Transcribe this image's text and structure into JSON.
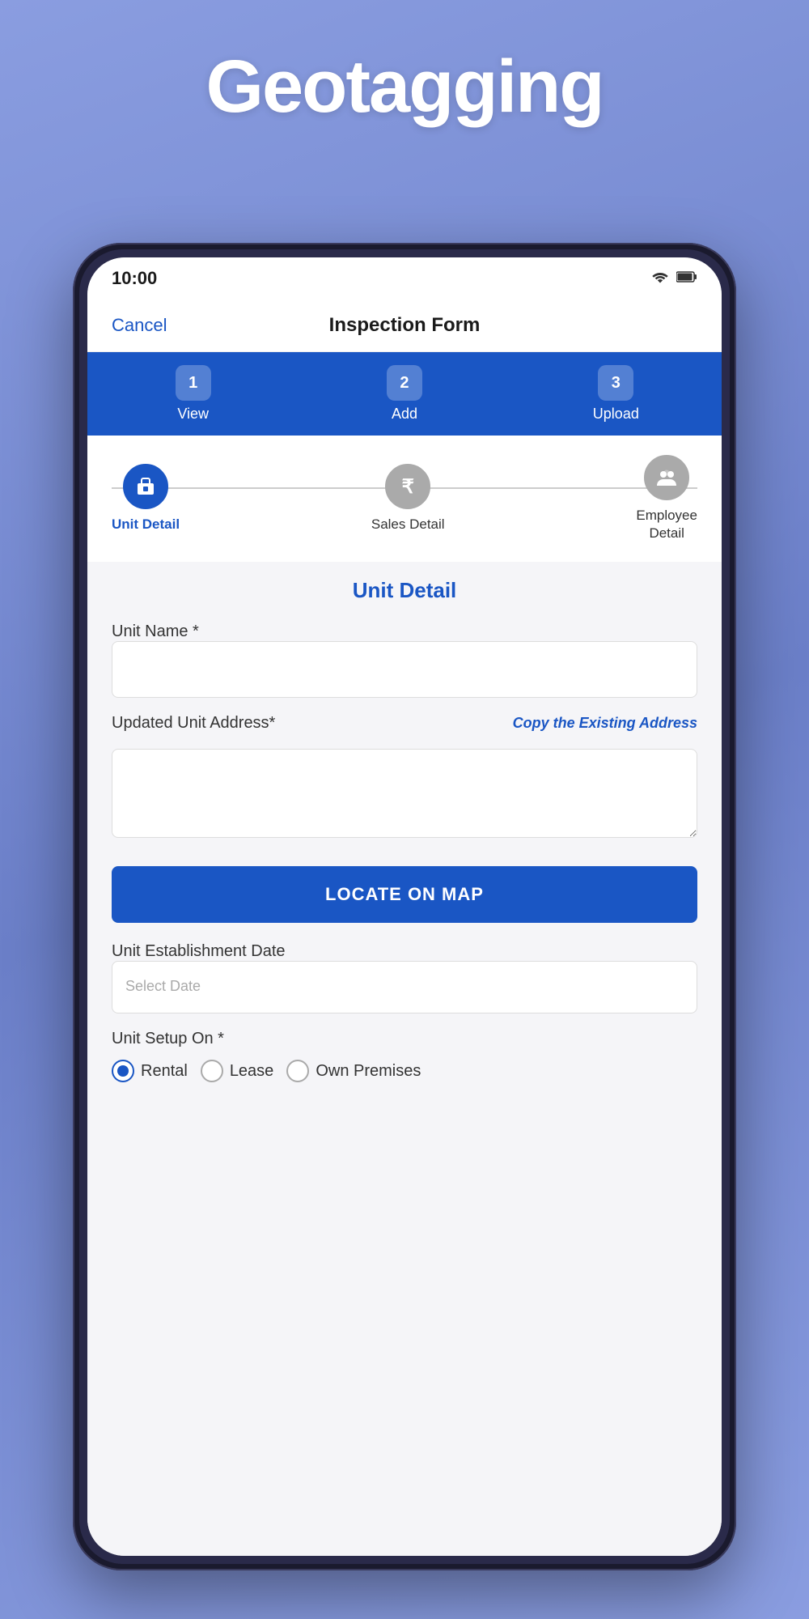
{
  "page": {
    "title": "Geotagging",
    "background_color": "#8a9de0"
  },
  "status_bar": {
    "time": "10:00",
    "wifi_icon": "wifi-icon",
    "battery_icon": "battery-icon"
  },
  "header": {
    "cancel_label": "Cancel",
    "title": "Inspection Form"
  },
  "tabs": [
    {
      "id": "view",
      "number": "1",
      "label": "View"
    },
    {
      "id": "add",
      "number": "2",
      "label": "Add"
    },
    {
      "id": "upload",
      "number": "3",
      "label": "Upload"
    }
  ],
  "stepper": {
    "steps": [
      {
        "id": "unit-detail",
        "icon": "🏪",
        "label": "Unit Detail",
        "state": "active"
      },
      {
        "id": "sales-detail",
        "icon": "₹",
        "label": "Sales Detail",
        "state": "inactive"
      },
      {
        "id": "employee-detail",
        "icon": "👥",
        "label": "Employee Detail",
        "state": "inactive"
      }
    ]
  },
  "form": {
    "section_title": "Unit Detail",
    "unit_name_label": "Unit Name *",
    "unit_name_placeholder": "",
    "unit_address_label": "Updated Unit Address*",
    "copy_address_label": "Copy the Existing Address",
    "unit_address_placeholder": "",
    "locate_btn_label": "LOCATE ON MAP",
    "establishment_date_label": "Unit Establishment Date",
    "establishment_date_placeholder": "Select Date",
    "unit_setup_label": "Unit Setup On *",
    "radio_options": [
      {
        "id": "rental",
        "label": "Rental",
        "selected": true
      },
      {
        "id": "lease",
        "label": "Lease",
        "selected": false
      },
      {
        "id": "own",
        "label": "Own Premises",
        "selected": false
      }
    ]
  }
}
